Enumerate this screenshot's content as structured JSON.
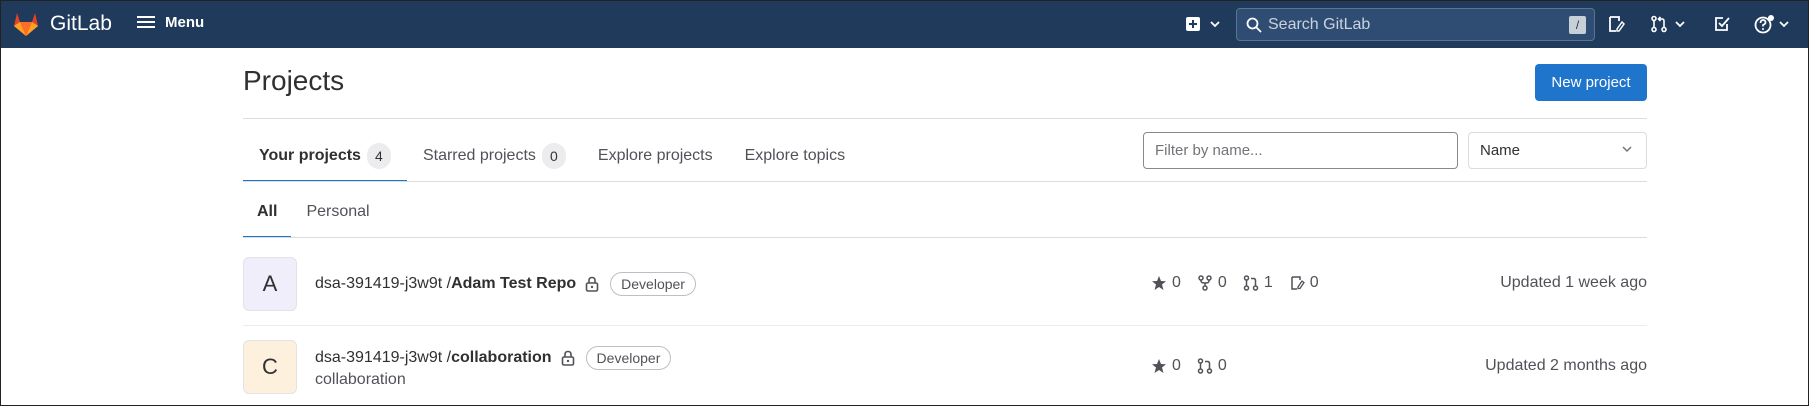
{
  "navbar": {
    "brand": "GitLab",
    "menu_label": "Menu",
    "search_placeholder": "Search GitLab",
    "search_shortcut": "/",
    "icons": [
      "create-new-icon",
      "issues-icon",
      "merge-requests-icon",
      "todos-icon",
      "help-icon"
    ],
    "bg_color": "#1f3a5b"
  },
  "page": {
    "title": "Projects",
    "new_project_label": "New project"
  },
  "tabs": [
    {
      "label": "Your projects",
      "count": "4",
      "active": true
    },
    {
      "label": "Starred projects",
      "count": "0",
      "active": false
    },
    {
      "label": "Explore projects",
      "count": null,
      "active": false
    },
    {
      "label": "Explore topics",
      "count": null,
      "active": false
    }
  ],
  "filter": {
    "placeholder": "Filter by name...",
    "sort_value": "Name"
  },
  "subtabs": [
    {
      "label": "All",
      "active": true
    },
    {
      "label": "Personal",
      "active": false
    }
  ],
  "projects": [
    {
      "avatar_letter": "A",
      "avatar_color": "#f0eefb",
      "namespace": "dsa-391419-j3w9t / ",
      "name": "Adam Test Repo",
      "role": "Developer",
      "description": "",
      "stars": "0",
      "forks": "0",
      "merge_requests": "1",
      "issues": "0",
      "updated": "Updated 1 week ago"
    },
    {
      "avatar_letter": "C",
      "avatar_color": "#fdf1dd",
      "namespace": "dsa-391419-j3w9t / ",
      "name": "collaboration",
      "role": "Developer",
      "description": "collaboration",
      "stars": "0",
      "merge_requests": "0",
      "updated": "Updated 2 months ago"
    }
  ]
}
